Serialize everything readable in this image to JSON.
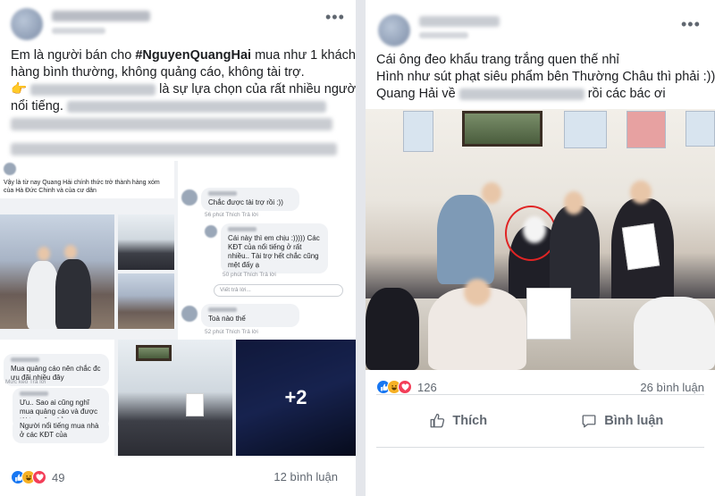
{
  "left_post": {
    "lines": [
      {
        "parts": [
          {
            "text": "Em là người bán cho ",
            "style": "normal"
          },
          {
            "text": "#NguyenQuangHai",
            "style": "hashtag"
          },
          {
            "text": " mua như 1 khách",
            "style": "normal"
          }
        ]
      },
      {
        "parts": [
          {
            "text": "hàng bình thường, không quảng cáo, không tài trợ.",
            "style": "normal"
          }
        ]
      },
      {
        "parts": [
          {
            "text": "👉 ",
            "style": "normal"
          },
          {
            "text": "",
            "style": "blur"
          },
          {
            "text": " là sự lựa chọn của rất nhiều người",
            "style": "normal"
          }
        ]
      },
      {
        "parts": [
          {
            "text": "nổi tiếng. ",
            "style": "normal"
          },
          {
            "text": "",
            "style": "blur"
          }
        ]
      }
    ],
    "collage": {
      "mini_post_text": "Vậy là từ nay Quang Hải chính thức trở thành hàng xóm của Hà Đức Chinh và của cư dân",
      "mini_comments": [
        {
          "text": "Chắc được tài trợ rồi :))",
          "meta": "56 phút   Thích   Trả lời"
        },
        {
          "text": "Cái này thì em chịu :)))))  Các KĐT của        nổi tiếng ở rất nhiều..  Tài trợ hết chắc cũng mệt đấy ạ",
          "meta": "50 phút   Thích   Trả lời"
        },
        {
          "text": "Toà nào thế",
          "meta": "52 phút   Thích   Trả lời"
        },
        {
          "text": "Mua quảng cáo nên chắc đc ưu đãi nhiều đây",
          "meta": "Mức kéo   Trả lời"
        },
        {
          "text": "Ưu.. Sao ai cũng nghĩ mua quảng cáo và được tài trợ vậy nhỉ",
          "meta": "Thích   Trả lời"
        },
        {
          "text": "Người nổi tiếng mua nhà ở các KĐT của",
          "meta": ""
        }
      ],
      "reply_placeholder": "Viết trả lời...",
      "more_photos": "+2"
    },
    "reaction_count": "49",
    "comment_count": "12 bình luận"
  },
  "right_post": {
    "lines": [
      "Cái ông đeo khẩu trang trắng quen thế nhỉ",
      "Hình như sút phạt siêu phẩm bên Thường Châu thì phải :))"
    ],
    "line3_prefix": "Quang Hải về ",
    "line3_suffix": " rồi các bác ơi",
    "reaction_count": "126",
    "comment_count": "26 bình luận",
    "like_label": "Thích",
    "comment_label": "Bình luận"
  },
  "colors": {
    "divider": "#e4e6eb",
    "text_primary": "#1c1e21",
    "text_secondary": "#606770",
    "like_blue": "#1877f2",
    "haha_yellow": "#f7b125",
    "love_red": "#f33e58",
    "highlight_circle": "#e02424"
  },
  "icons": [
    "more-options-icon",
    "like-reaction-icon",
    "haha-reaction-icon",
    "love-reaction-icon",
    "thumbs-up-icon",
    "comment-bubble-icon",
    "pointing-hand-emoji"
  ]
}
